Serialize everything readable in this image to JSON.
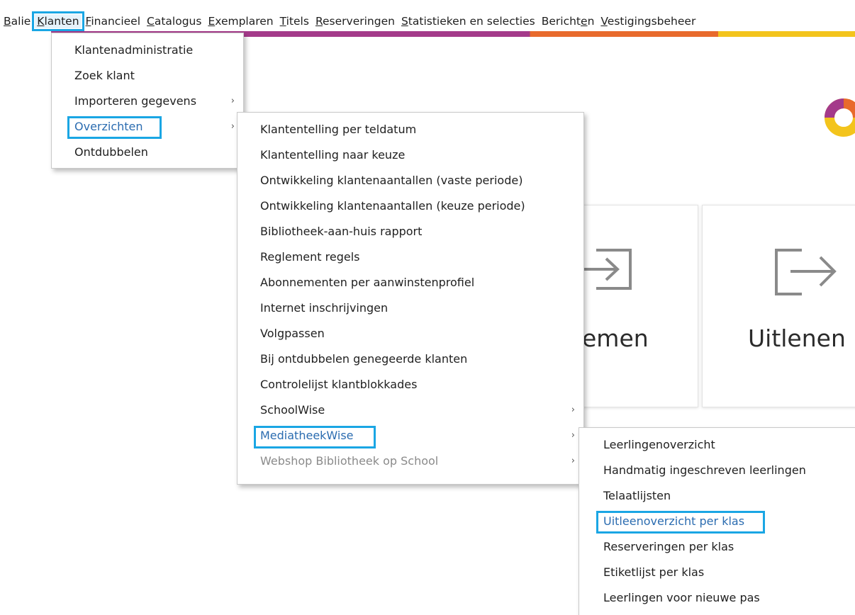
{
  "menubar": {
    "items": [
      {
        "label": "Balie",
        "u": "B",
        "rest": "alie"
      },
      {
        "label": "Klanten",
        "u": "K",
        "rest": "lanten"
      },
      {
        "label": "Financieel",
        "u": "F",
        "rest": "inancieel"
      },
      {
        "label": "Catalogus",
        "u": "C",
        "rest": "atalogus"
      },
      {
        "label": "Exemplaren",
        "u": "E",
        "rest": "xemplaren"
      },
      {
        "label": "Titels",
        "u": "T",
        "rest": "itels"
      },
      {
        "label": "Reserveringen",
        "u": "R",
        "rest": "eserveringen"
      },
      {
        "label": "Statistieken en selecties",
        "u": "S",
        "rest": "tatistieken en selecties"
      },
      {
        "label": "Berichten",
        "pre": "Bericht",
        "u": "e",
        "post": "n"
      },
      {
        "label": "Vestigingsbeheer",
        "u": "V",
        "rest": "estigingsbeheer"
      }
    ]
  },
  "klanten_menu": {
    "items": [
      {
        "label": "Klantenadministratie",
        "has_sub": false
      },
      {
        "label": "Zoek klant",
        "has_sub": false
      },
      {
        "label": "Importeren gegevens",
        "has_sub": true
      },
      {
        "label": "Overzichten",
        "has_sub": true
      },
      {
        "label": "Ontdubbelen",
        "has_sub": false
      }
    ]
  },
  "overzichten_menu": {
    "items": [
      {
        "label": "Klantentelling per teldatum"
      },
      {
        "label": "Klantentelling naar keuze"
      },
      {
        "label": "Ontwikkeling klantenaantallen (vaste periode)"
      },
      {
        "label": "Ontwikkeling klantenaantallen (keuze periode)"
      },
      {
        "label": "Bibliotheek-aan-huis rapport"
      },
      {
        "label": "Reglement regels"
      },
      {
        "label": "Abonnementen per aanwinstenprofiel"
      },
      {
        "label": "Internet inschrijvingen"
      },
      {
        "label": "Volgpassen"
      },
      {
        "label": "Bij ontdubbelen genegeerde klanten"
      },
      {
        "label": "Controlelijst klantblokkades"
      },
      {
        "label": "SchoolWise"
      },
      {
        "label": "MediatheekWise"
      },
      {
        "label": "Webshop Bibliotheek op School"
      }
    ]
  },
  "mediatheekwise_menu": {
    "items": [
      {
        "label": "Leerlingenoverzicht"
      },
      {
        "label": "Handmatig ingeschreven leerlingen"
      },
      {
        "label": "Telaatlijsten"
      },
      {
        "label": "Uitleenoverzicht per klas"
      },
      {
        "label": "Reserveringen per klas"
      },
      {
        "label": "Etiketlijst per klas"
      },
      {
        "label": "Leerlingen voor nieuwe pas"
      }
    ]
  },
  "tiles": {
    "innemen_label": "emen",
    "uitlenen_label": "Uitlenen"
  },
  "icons": {
    "chevron": "chevron-right-icon",
    "return": "return-arrow-icon",
    "lend": "lend-arrow-icon",
    "logo": "brand-logo-icon"
  },
  "colors": {
    "highlight": "#1aa6e4",
    "link": "#2b6cb0",
    "brand_purple": "#a43a8a",
    "brand_orange": "#e86a2c",
    "brand_yellow": "#f3c41c"
  }
}
